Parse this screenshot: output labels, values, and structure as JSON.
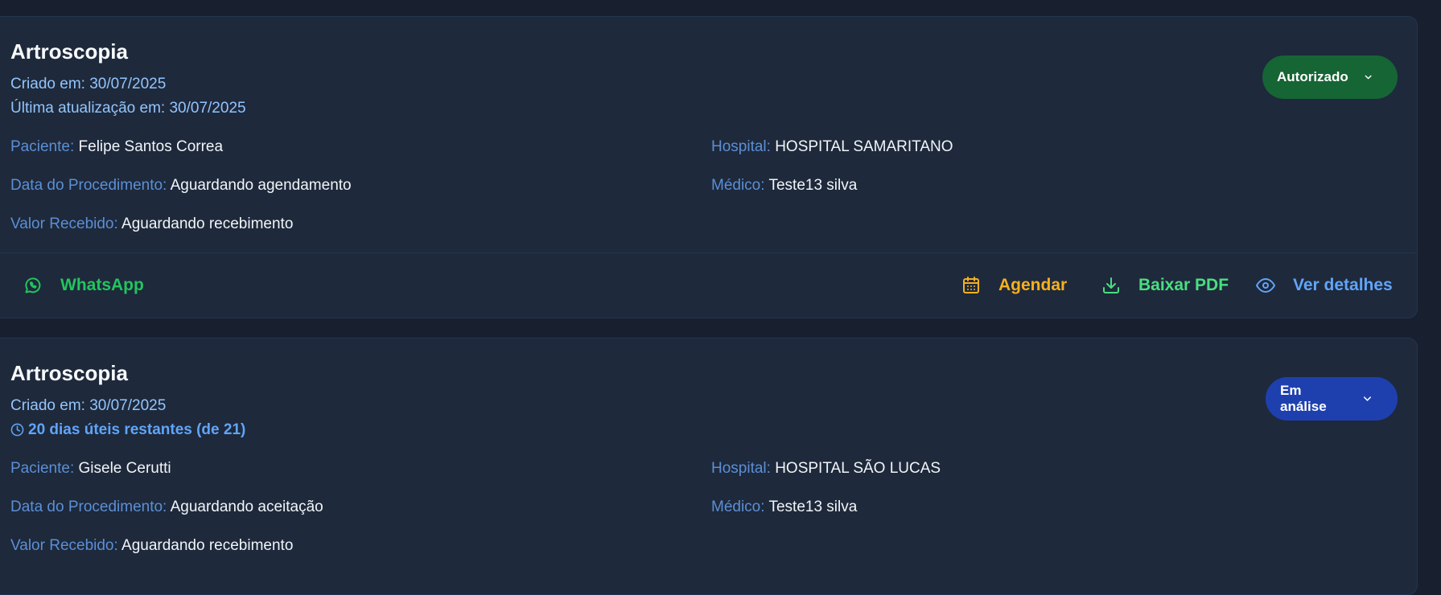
{
  "cards": [
    {
      "title": "Artroscopia",
      "created_label": "Criado em:",
      "created_value": "30/07/2025",
      "updated_label": "Última atualização em:",
      "updated_value": "30/07/2025",
      "status": "Autorizado",
      "status_color": "#166534",
      "patient_label": "Paciente:",
      "patient_value": "Felipe Santos Correa",
      "procedure_date_label": "Data do Procedimento:",
      "procedure_date_value": "Aguardando agendamento",
      "received_label": "Valor Recebido:",
      "received_value": "Aguardando recebimento",
      "hospital_label": "Hospital:",
      "hospital_value": "HOSPITAL SAMARITANO",
      "doctor_label": "Médico:",
      "doctor_value": "Teste13 silva",
      "actions": {
        "whatsapp": "WhatsApp",
        "schedule": "Agendar",
        "download_pdf": "Baixar PDF",
        "details": "Ver detalhes"
      }
    },
    {
      "title": "Artroscopia",
      "created_label": "Criado em:",
      "created_value": "30/07/2025",
      "remaining": "20 dias úteis restantes (de 21)",
      "status": "Em análise",
      "status_color": "#1e40af",
      "patient_label": "Paciente:",
      "patient_value": "Gisele Cerutti",
      "procedure_date_label": "Data do Procedimento:",
      "procedure_date_value": "Aguardando aceitação",
      "received_label": "Valor Recebido:",
      "received_value": "Aguardando recebimento",
      "hospital_label": "Hospital:",
      "hospital_value": "HOSPITAL SÃO LUCAS",
      "doctor_label": "Médico:",
      "doctor_value": "Teste13 silva"
    }
  ],
  "icons": {
    "whatsapp": "whatsapp-icon",
    "schedule": "calendar-icon",
    "download": "download-icon",
    "details": "eye-icon",
    "dropdown": "chevron-down-icon",
    "remaining": "clock-icon"
  }
}
